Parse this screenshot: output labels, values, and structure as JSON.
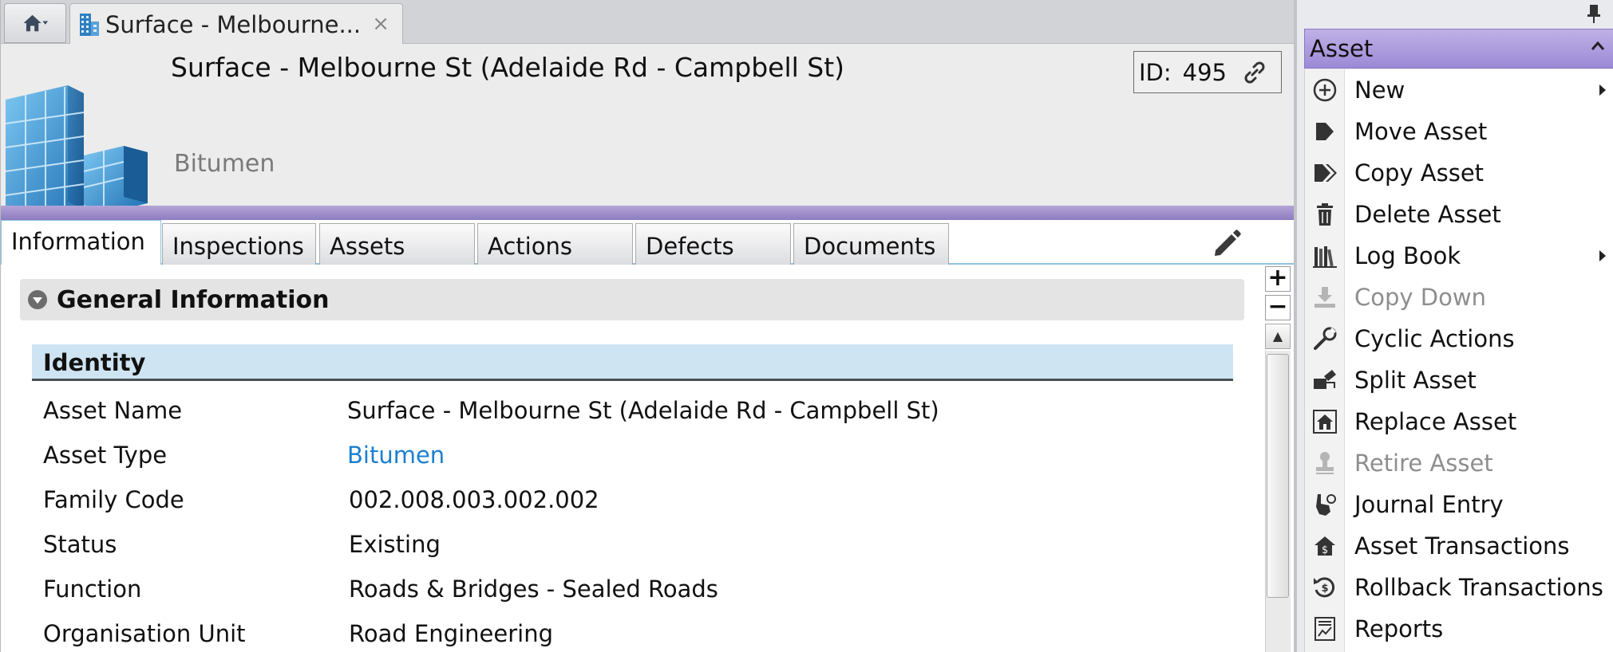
{
  "window": {
    "doc_tab_title": "Surface - Melbourne...",
    "close_glyph": "×"
  },
  "header": {
    "asset_title": "Surface - Melbourne St (Adelaide Rd - Campbell St)",
    "asset_subtitle": "Bitumen",
    "id_label": "ID:",
    "id_value": "495"
  },
  "tabs": [
    {
      "label": "Information",
      "active": true
    },
    {
      "label": "Inspections"
    },
    {
      "label": "Assets"
    },
    {
      "label": "Actions"
    },
    {
      "label": "Defects"
    },
    {
      "label": "Documents"
    }
  ],
  "content": {
    "section_title": "General Information",
    "group_title": "Identity",
    "zoom_in": "+",
    "zoom_out": "−",
    "fields": [
      {
        "label": "Asset Name",
        "value": "Surface - Melbourne St (Adelaide Rd - Campbell St)"
      },
      {
        "label": "Asset Type",
        "value": "Bitumen",
        "link": true
      },
      {
        "label": "Family Code",
        "value": "002.008.003.002.002"
      },
      {
        "label": "Status",
        "value": "Existing"
      },
      {
        "label": "Function",
        "value": "Roads & Bridges - Sealed Roads"
      },
      {
        "label": "Organisation Unit",
        "value": "Road Engineering"
      }
    ]
  },
  "menu": {
    "header": "Asset",
    "items": [
      {
        "label": "New",
        "icon": "plus-circle-icon",
        "submenu": true
      },
      {
        "label": "Move Asset",
        "icon": "move-arrow-icon"
      },
      {
        "label": "Copy Asset",
        "icon": "copy-arrow-icon"
      },
      {
        "label": "Delete Asset",
        "icon": "trash-icon"
      },
      {
        "label": "Log Book",
        "icon": "books-icon",
        "submenu": true
      },
      {
        "label": "Copy Down",
        "icon": "download-tray-icon",
        "disabled": true
      },
      {
        "label": "Cyclic Actions",
        "icon": "wrench-icon"
      },
      {
        "label": "Split Asset",
        "icon": "split-icon"
      },
      {
        "label": "Replace Asset",
        "icon": "house-replace-icon"
      },
      {
        "label": "Retire Asset",
        "icon": "stamp-icon",
        "disabled": true
      },
      {
        "label": "Journal Entry",
        "icon": "hand-coin-icon"
      },
      {
        "label": "Asset Transactions",
        "icon": "house-dollar-icon"
      },
      {
        "label": "Rollback Transactions",
        "icon": "rollback-dollar-icon"
      },
      {
        "label": "Reports",
        "icon": "report-chart-icon"
      }
    ]
  },
  "colors": {
    "accent_purple": "#9c89d6",
    "tab_underline": "#8fc3e2",
    "identity_band": "#cfe4f2",
    "link_blue": "#1a7fd0"
  }
}
